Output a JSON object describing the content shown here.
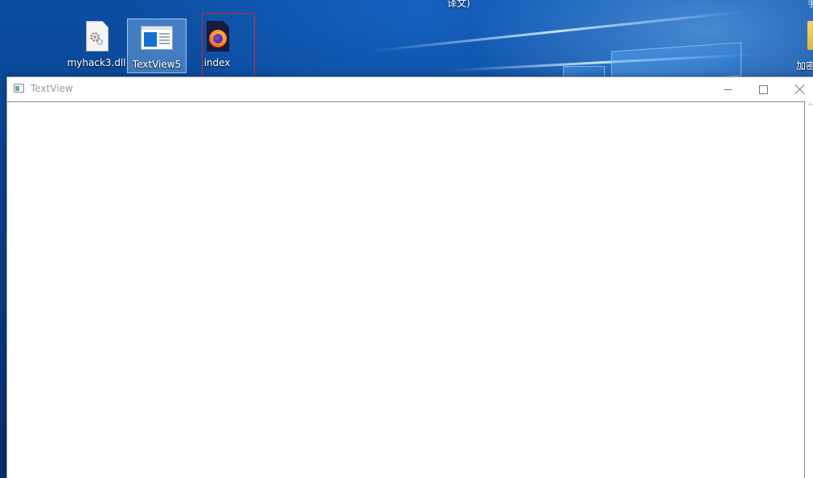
{
  "desktop": {
    "top_caption": "译文)",
    "edge_glyph": "手",
    "icons": [
      {
        "label": "myhack3.dll",
        "icon": "dll-file-icon",
        "selected": false
      },
      {
        "label": "TextView5",
        "icon": "app-window-icon",
        "selected": true
      },
      {
        "label": "index",
        "icon": "firefox-html-icon",
        "selected": false,
        "highlighted": true
      }
    ],
    "edge_folder_label": "加密"
  },
  "window": {
    "title": "TextView",
    "app_icon": "app-window-icon",
    "controls": {
      "minimize_icon": "minimize-icon",
      "maximize_icon": "maximize-icon",
      "close_icon": "close-icon"
    },
    "scroll_glyph": "^",
    "content_text": ""
  },
  "colors": {
    "wallpaper": "#0a3f86",
    "highlight_box": "#d62a2a",
    "selection": "#add8ff"
  }
}
